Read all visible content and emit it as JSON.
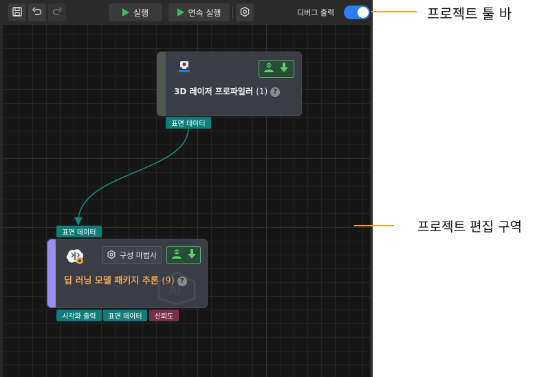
{
  "toolbar": {
    "run_label": "실행",
    "run_continuous_label": "연속 실행",
    "debug_output_label": "디버그 출력",
    "debug_output_on": true,
    "icons": [
      "save-icon",
      "undo-icon",
      "redo-icon",
      "settings-icon"
    ]
  },
  "nodes": {
    "profiler": {
      "title": "3D 레이저 프로파일러",
      "count": "(1)",
      "help": "?",
      "output_port": "표면 데이터",
      "stripe_color": "#505650"
    },
    "inference": {
      "title": "딥 러닝 모델 패키지 추론",
      "count": "(9)",
      "help": "?",
      "input_port": "표면 데이터",
      "wizard_label": "구성 마법사",
      "output_ports": [
        "시각화 출력",
        "표면 데이터",
        "신뢰도"
      ],
      "stripe_color": "#9b8cf0",
      "title_color": "#f0a25a"
    }
  },
  "annotations": {
    "toolbar": "프로젝트 툴 바",
    "editor": "프로젝트 편집 구역"
  },
  "colors": {
    "accent_toggle": "#2a7df2",
    "annotation_line": "#f5a31a",
    "connection": "#0e8a80",
    "play": "#3cbf5a"
  }
}
